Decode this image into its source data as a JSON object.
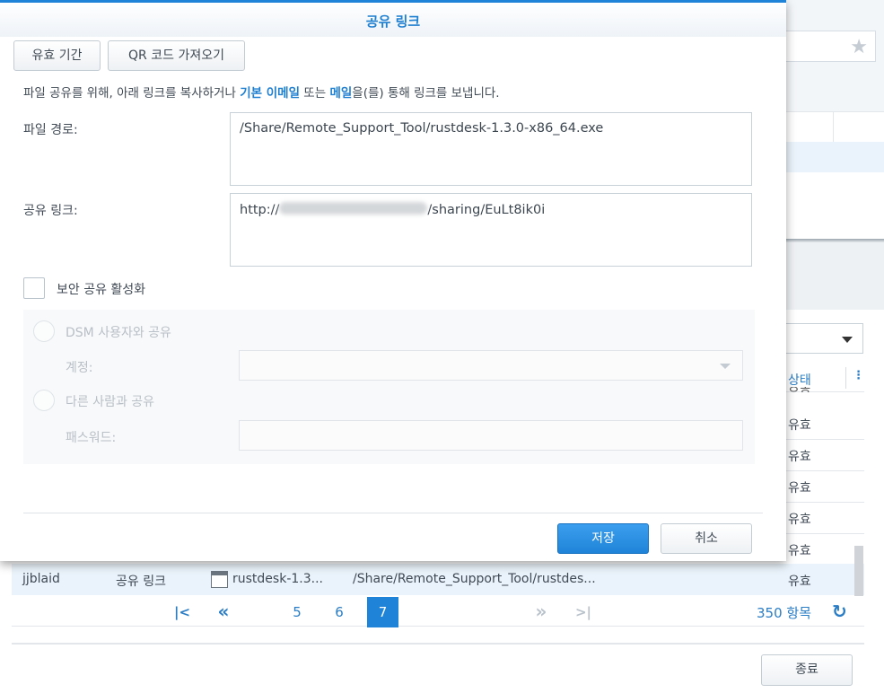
{
  "dialog": {
    "title": "공유 링크",
    "validity_button": "유효 기간",
    "qr_button": "QR 코드 가져오기",
    "description": {
      "part1": "파일 공유를 위해, 아래 링크를 복사하거나 ",
      "link1": "기본 이메일",
      "part2": " 또는 ",
      "link2": "메일",
      "part3": "을(를) 통해 링크를 보냅니다."
    },
    "file_path_label": "파일 경로:",
    "file_path_value": "/Share/Remote_Support_Tool/rustdesk-1.3.0-x86_64.exe",
    "share_link_label": "공유 링크:",
    "share_link_prefix": "http://",
    "share_link_suffix": "/sharing/EuLt8ik0i",
    "secure_share_label": "보안 공유 활성화",
    "dsm_user_option": "DSM 사용자와 공유",
    "account_label": "계정:",
    "others_option": "다른 사람과 공유",
    "password_label": "패스워드:",
    "save_button": "저장",
    "cancel_button": "취소"
  },
  "background": {
    "status_header": "상태",
    "status_values": [
      "유효",
      "유효",
      "유효",
      "유효",
      "유효"
    ],
    "row": {
      "user": "jjblaid",
      "type": "공유 링크",
      "file": "rustdesk-1.3...",
      "path": "/Share/Remote_Support_Tool/rustdes...",
      "status": "유효"
    },
    "pager": {
      "pages": [
        "5",
        "6",
        "7"
      ],
      "active_page": "7",
      "total": "350 항목"
    },
    "close_button": "종료"
  },
  "icons": {
    "star": "star-icon",
    "first_page": "first-page-icon",
    "prev_page": "prev-page-icon",
    "next_page": "next-page-icon",
    "last_page": "last-page-icon",
    "refresh": "refresh-icon",
    "file": "file-icon",
    "more": "more-vertical-icon",
    "dropdown": "chevron-down-icon"
  },
  "colors": {
    "accent": "#1f84d8",
    "link": "#1f7fd0",
    "selected_row": "#eaf3fb"
  }
}
